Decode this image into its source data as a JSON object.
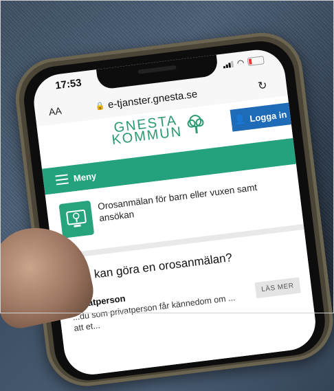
{
  "status": {
    "time": "17:53"
  },
  "browser": {
    "text_size_label": "AA",
    "url": "e-tjanster.gnesta.se"
  },
  "site": {
    "logo_line1": "GNESTA",
    "logo_line2": "KOMMUN",
    "login_label": "Logga in",
    "menu_label": "Meny",
    "brand_color": "#24a27d",
    "login_color": "#1e6bb8"
  },
  "card": {
    "title": "Orosanmälan för barn eller vuxen samt ansökan"
  },
  "section": {
    "question": "Vem kan göra en orosanmälan?",
    "subheading": "Privatperson",
    "body": "...du som privatperson får kännedom om ... att et...",
    "read_more": "LÄS MER"
  }
}
